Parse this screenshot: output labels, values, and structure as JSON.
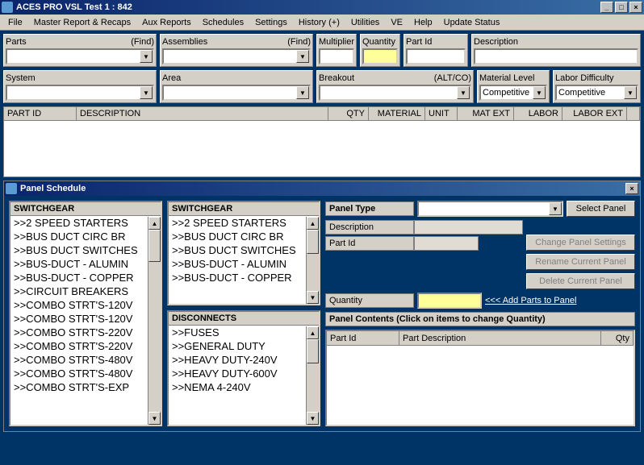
{
  "window": {
    "title": "ACES PRO  VSL Test 1 : 842"
  },
  "menu": [
    "File",
    "Master Report & Recaps",
    "Aux Reports",
    "Schedules",
    "Settings",
    "History (+)",
    "Utilities",
    "VE",
    "Help",
    "Update Status"
  ],
  "searchRow1": {
    "parts": {
      "label": "Parts",
      "hint": "(Find)"
    },
    "assemblies": {
      "label": "Assemblies",
      "hint": "(Find)"
    },
    "multiplier": {
      "label": "Multiplier"
    },
    "quantity": {
      "label": "Quantity"
    },
    "partid": {
      "label": "Part Id"
    },
    "description": {
      "label": "Description"
    }
  },
  "searchRow2": {
    "system": {
      "label": "System"
    },
    "area": {
      "label": "Area"
    },
    "breakout": {
      "label": "Breakout",
      "hint": "(ALT/CO)"
    },
    "matlevel": {
      "label": "Material Level",
      "value": "Competitive"
    },
    "labdiff": {
      "label": "Labor Difficulty",
      "value": "Competitive"
    }
  },
  "gridCols": [
    "PART ID",
    "DESCRIPTION",
    "QTY",
    "MATERIAL",
    "UNIT",
    "MAT EXT",
    "LABOR",
    "LABOR EXT"
  ],
  "panelSchedule": {
    "title": "Panel Schedule",
    "switchgearHdr": "SWITCHGEAR",
    "switchgear": [
      ">>2 SPEED STARTERS",
      ">>BUS DUCT CIRC BR",
      ">>BUS DUCT SWITCHES",
      ">>BUS-DUCT - ALUMIN",
      ">>BUS-DUCT - COPPER",
      ">>CIRCUIT BREAKERS",
      ">>COMBO STRT'S-120V",
      ">>COMBO STRT'S-120V",
      ">>COMBO STRT'S-220V",
      ">>COMBO STRT'S-220V",
      ">>COMBO STRT'S-480V",
      ">>COMBO STRT'S-480V",
      ">>COMBO STRT'S-EXP"
    ],
    "switchgear2": [
      ">>2 SPEED STARTERS",
      ">>BUS DUCT CIRC BR",
      ">>BUS DUCT SWITCHES",
      ">>BUS-DUCT - ALUMIN",
      ">>BUS-DUCT - COPPER"
    ],
    "disconnectsHdr": "DISCONNECTS",
    "disconnects": [
      ">>FUSES",
      ">>GENERAL DUTY",
      ">>HEAVY DUTY-240V",
      ">>HEAVY DUTY-600V",
      ">>NEMA 4-240V"
    ],
    "right": {
      "panelTypeLbl": "Panel Type",
      "selectPanelBtn": "Select Panel",
      "descLbl": "Description",
      "partIdLbl": "Part Id",
      "changeBtn": "Change Panel Settings",
      "renameBtn": "Rename Current Panel",
      "deleteBtn": "Delete Current Panel",
      "qtyLbl": "Quantity",
      "addLink": "<<< Add Parts to Panel",
      "contentsHdr": "Panel Contents  (Click on items to change Quantity)",
      "contCols": [
        "Part Id",
        "Part Description",
        "Qty"
      ]
    }
  }
}
